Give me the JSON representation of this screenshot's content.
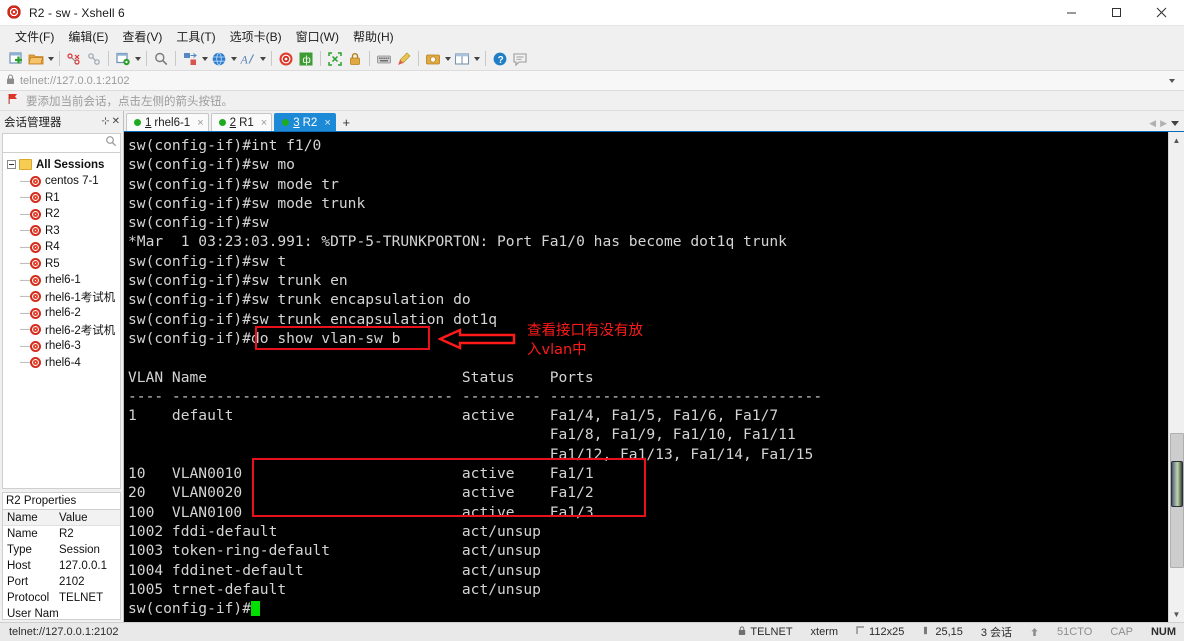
{
  "window": {
    "title": "R2 - sw - Xshell 6",
    "icon": "xshell-spiral-icon",
    "minimize": "minimize",
    "maximize": "maximize",
    "close": "close"
  },
  "menu": [
    {
      "label": "文件(F)"
    },
    {
      "label": "编辑(E)"
    },
    {
      "label": "查看(V)"
    },
    {
      "label": "工具(T)"
    },
    {
      "label": "选项卡(B)"
    },
    {
      "label": "窗口(W)"
    },
    {
      "label": "帮助(H)"
    }
  ],
  "toolbar": {
    "items": [
      "new-session-icon",
      "open-folder-icon",
      "folder-dropdown-caret",
      "disconnect-icon",
      "link-icon",
      "session-manager-icon",
      "session-dropdown-caret",
      "find-icon",
      "transfer-icon",
      "transfer-dropdown-caret",
      "globe-icon",
      "globe-dropdown-caret",
      "font-icon",
      "font-dropdown-caret",
      "xshell-icon",
      "xftp-icon",
      "fullscreen-icon",
      "lock-icon",
      "keyboard-icon",
      "highlight-icon",
      "capture-icon",
      "capture-dropdown-caret",
      "layout-icon",
      "layout-dropdown-caret",
      "help-icon",
      "comment-icon"
    ]
  },
  "address": {
    "icon": "lock-icon",
    "value": "telnet://127.0.0.1:2102",
    "caret": "chevron-down-icon"
  },
  "hint": {
    "icon": "red-flag-icon",
    "text": "要添加当前会话，点击左侧的箭头按钮。"
  },
  "sidebar": {
    "title": "会话管理器",
    "pin_icon": "pin-icon",
    "close_icon": "close-icon",
    "search_icon": "search-icon",
    "root": "All Sessions",
    "items": [
      {
        "label": "centos 7-1"
      },
      {
        "label": "R1"
      },
      {
        "label": "R2"
      },
      {
        "label": "R3"
      },
      {
        "label": "R4"
      },
      {
        "label": "R5"
      },
      {
        "label": "rhel6-1"
      },
      {
        "label": "rhel6-1考试机"
      },
      {
        "label": "rhel6-2"
      },
      {
        "label": "rhel6-2考试机"
      },
      {
        "label": "rhel6-3"
      },
      {
        "label": "rhel6-4"
      }
    ]
  },
  "properties": {
    "title": "R2 Properties",
    "headers": {
      "name": "Name",
      "value": "Value"
    },
    "rows": [
      {
        "name": "Name",
        "value": "R2"
      },
      {
        "name": "Type",
        "value": "Session"
      },
      {
        "name": "Host",
        "value": "127.0.0.1"
      },
      {
        "name": "Port",
        "value": "2102"
      },
      {
        "name": "Protocol",
        "value": "TELNET"
      },
      {
        "name": "User Name",
        "value": ""
      }
    ]
  },
  "tabs": {
    "items": [
      {
        "num": "1",
        "label": "rhel6-1",
        "active": false,
        "close": "×"
      },
      {
        "num": "2",
        "label": "R1",
        "active": false,
        "close": "×"
      },
      {
        "num": "3",
        "label": "R2",
        "active": true,
        "close": "×"
      }
    ],
    "add": "+",
    "prev": "◀",
    "next": "▶",
    "list": "tab-list-caret"
  },
  "terminal": {
    "lines": [
      "sw(config-if)#int f1/0",
      "sw(config-if)#sw mo",
      "sw(config-if)#sw mode tr",
      "sw(config-if)#sw mode trunk",
      "sw(config-if)#sw",
      "*Mar  1 03:23:03.991: %DTP-5-TRUNKPORTON: Port Fa1/0 has become dot1q trunk",
      "sw(config-if)#sw t",
      "sw(config-if)#sw trunk en",
      "sw(config-if)#sw trunk encapsulation do",
      "sw(config-if)#sw trunk encapsulation dot1q",
      "sw(config-if)#do show vlan-sw b",
      "",
      "VLAN Name                             Status    Ports",
      "---- -------------------------------- --------- -------------------------------",
      "1    default                          active    Fa1/4, Fa1/5, Fa1/6, Fa1/7",
      "                                                Fa1/8, Fa1/9, Fa1/10, Fa1/11",
      "                                                Fa1/12, Fa1/13, Fa1/14, Fa1/15",
      "10   VLAN0010                         active    Fa1/1",
      "20   VLAN0020                         active    Fa1/2",
      "100  VLAN0100                         active    Fa1/3",
      "1002 fddi-default                     act/unsup",
      "1003 token-ring-default               act/unsup",
      "1004 fddinet-default                  act/unsup",
      "1005 trnet-default                    act/unsup",
      "sw(config-if)#"
    ],
    "cursor": "block-cursor",
    "annotations": {
      "command_note_line1": "查看接口有没有放",
      "command_note_line2": "入vlan中",
      "arrow": "left-arrow-annotation",
      "box_command": "highlight-box-command",
      "box_vlans": "highlight-box-vlan-rows"
    }
  },
  "scrollbar": {
    "up": "▲",
    "down": "▼",
    "thumb": "scroll-thumb"
  },
  "statusbar": {
    "url": "telnet://127.0.0.1:2102",
    "connection_icon": "lock-icon",
    "protocol": "TELNET",
    "term_type": "xterm",
    "size_icon": "size-icon",
    "size": "112x25",
    "cursor_icon": "cursor-icon",
    "cursor_pos": "25,15",
    "sessions": "3 会话",
    "upload_icon": "upload-icon",
    "watermark": "51CTO",
    "cap": "CAP",
    "num": "NUM"
  },
  "colors": {
    "accent": "#1c8ad6",
    "annotation_red": "#e8101b",
    "terminal_bg": "#000000",
    "terminal_fg": "#d4d4d4",
    "cursor_green": "#00e000"
  }
}
